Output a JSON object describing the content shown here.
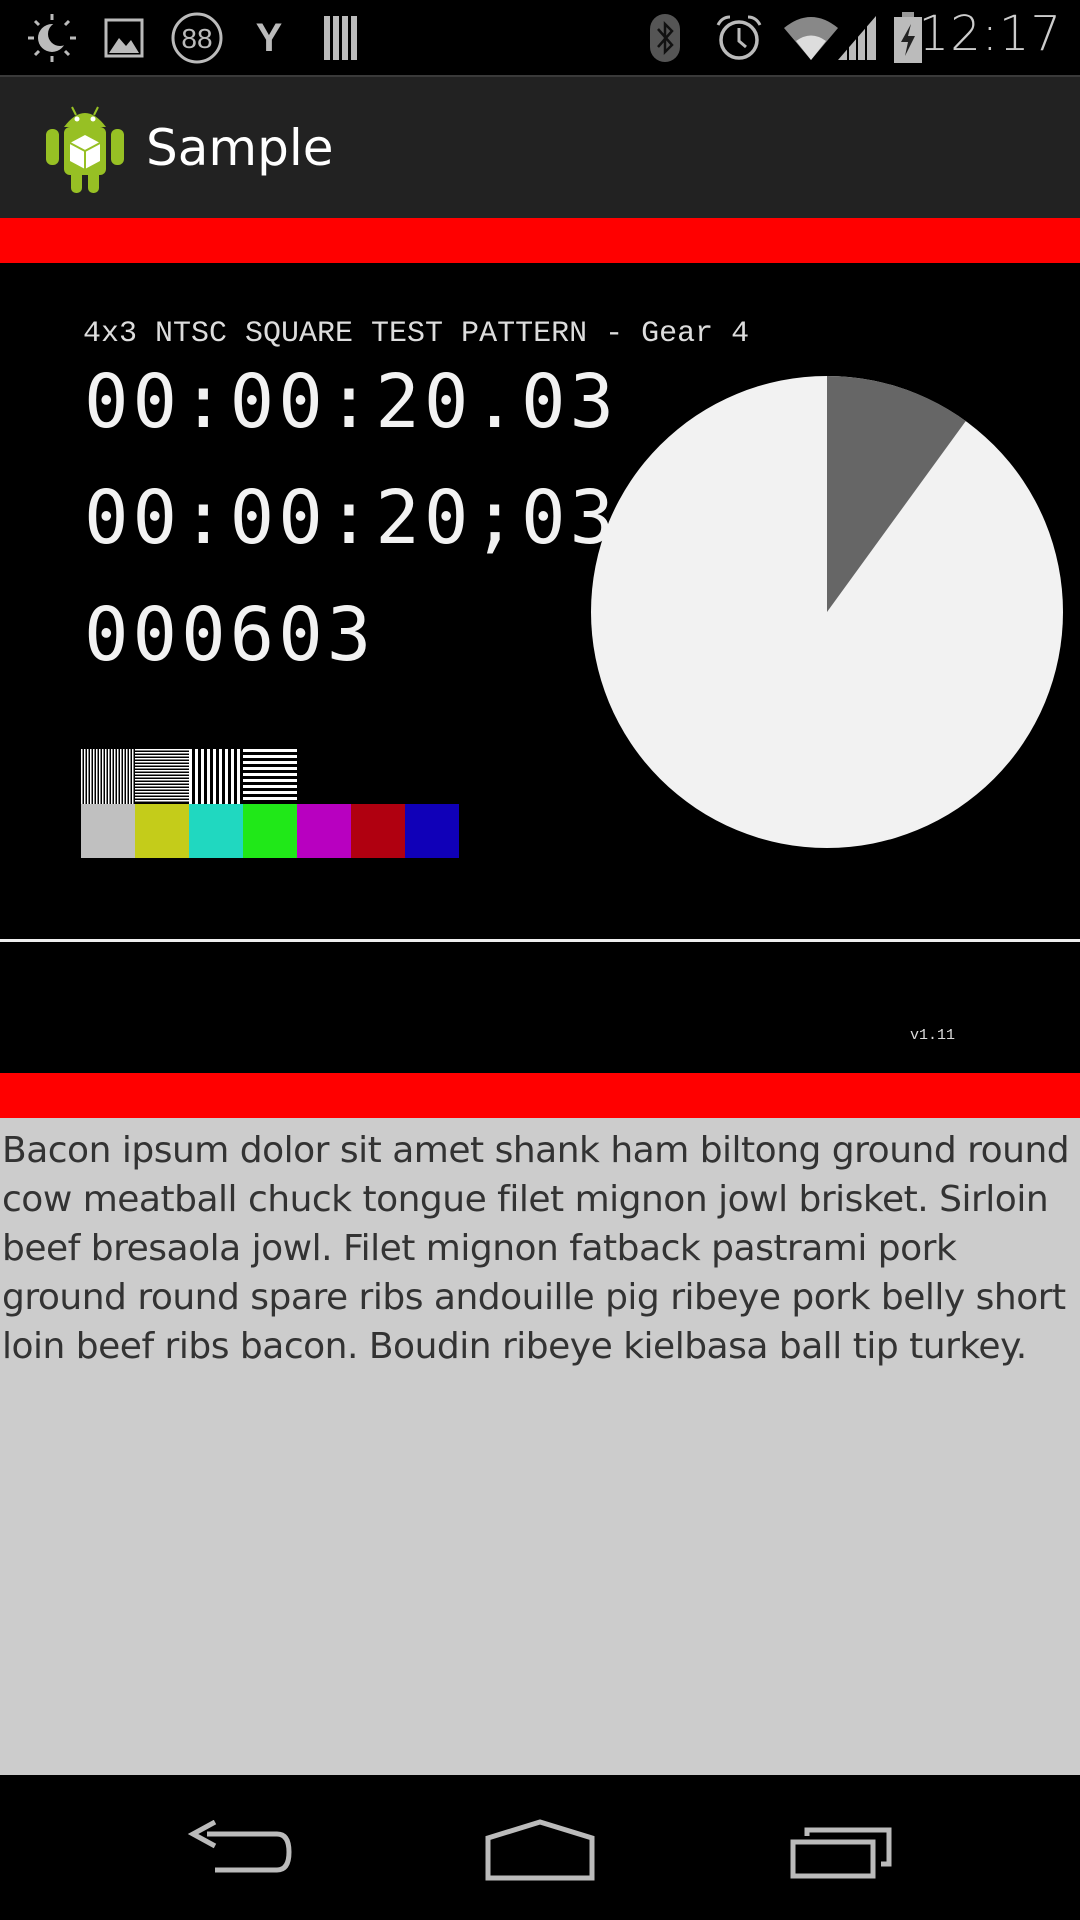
{
  "status_bar": {
    "time": "12:17",
    "notification_icons": [
      "brightness-icon",
      "image-icon",
      "badge-88-icon",
      "y-icon",
      "barcode-icon"
    ],
    "badge_text": "88",
    "y_text": "Y",
    "system_icons": [
      "bluetooth-icon",
      "alarm-icon",
      "wifi-icon",
      "signal-icon",
      "battery-charging-icon"
    ]
  },
  "action_bar": {
    "title": "Sample",
    "icon": "android-app-icon"
  },
  "video": {
    "pattern_title": "4x3 NTSC SQUARE TEST PATTERN - Gear 4",
    "timecode_decimal": "00:00:20.03",
    "timecode_dropframe": "00:00:20;03",
    "frame_count": "000603",
    "version": "v1.11",
    "pie_progress_fraction": 0.1,
    "colors": {
      "pie_light": "#f2f2f2",
      "pie_dark": "#666666",
      "accent_bar": "#ff0000"
    },
    "color_bars": [
      "#c0c0c0",
      "#c4cc1a",
      "#20d8c0",
      "#20e818",
      "#b800c0",
      "#b00010",
      "#1000b8"
    ]
  },
  "content": {
    "text": "Bacon ipsum dolor sit amet shank ham biltong ground round cow meatball chuck tongue filet mignon jowl brisket. Sirloin beef bresaola jowl. Filet mignon fatback pastrami pork ground round spare ribs andouille pig ribeye pork belly short loin beef ribs bacon. Boudin ribeye kielbasa ball tip turkey."
  },
  "nav_bar": {
    "buttons": [
      "back-icon",
      "home-icon",
      "recents-icon"
    ]
  }
}
